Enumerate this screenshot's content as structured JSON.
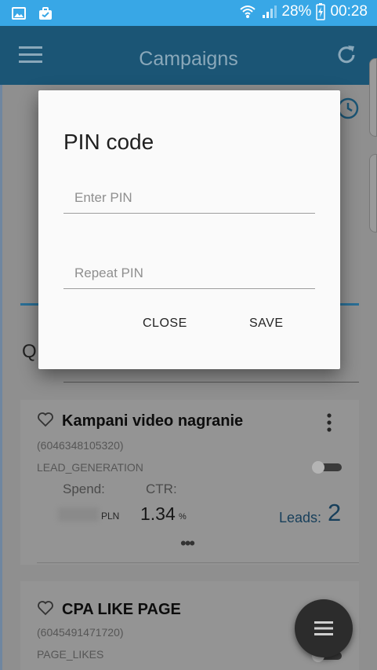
{
  "status_bar": {
    "battery": "28%",
    "time": "00:28",
    "icons": [
      "gallery-icon",
      "briefcase-icon",
      "wifi-icon",
      "signal-icon",
      "battery-icon"
    ]
  },
  "app_bar": {
    "title": "Campaigns",
    "icons": [
      "menu-icon",
      "refresh-icon"
    ]
  },
  "campaigns": [
    {
      "name": "Kampani video nagranie",
      "id": "(6046348105320)",
      "objective": "LEAD_GENERATION",
      "spend_label": "Spend:",
      "ctr_label": "CTR:",
      "currency": "PLN",
      "ctr_value": "1.34",
      "ctr_unit": "%",
      "leads_label": "Leads:",
      "leads_value": "2",
      "more": "•••"
    },
    {
      "name": "CPA LIKE PAGE",
      "id": "(6045491471720)",
      "objective": "PAGE_LIKES"
    }
  ],
  "pin_dialog": {
    "title": "PIN code",
    "enter_placeholder": "Enter PIN",
    "repeat_placeholder": "Repeat PIN",
    "close_label": "CLOSE",
    "save_label": "SAVE"
  },
  "search_glyph": "Q",
  "colors": {
    "status_bar": "#38a7e6",
    "app_bar": "#1b5575",
    "accent": "#2a6f96",
    "dialog_bg": "#fafafa"
  }
}
